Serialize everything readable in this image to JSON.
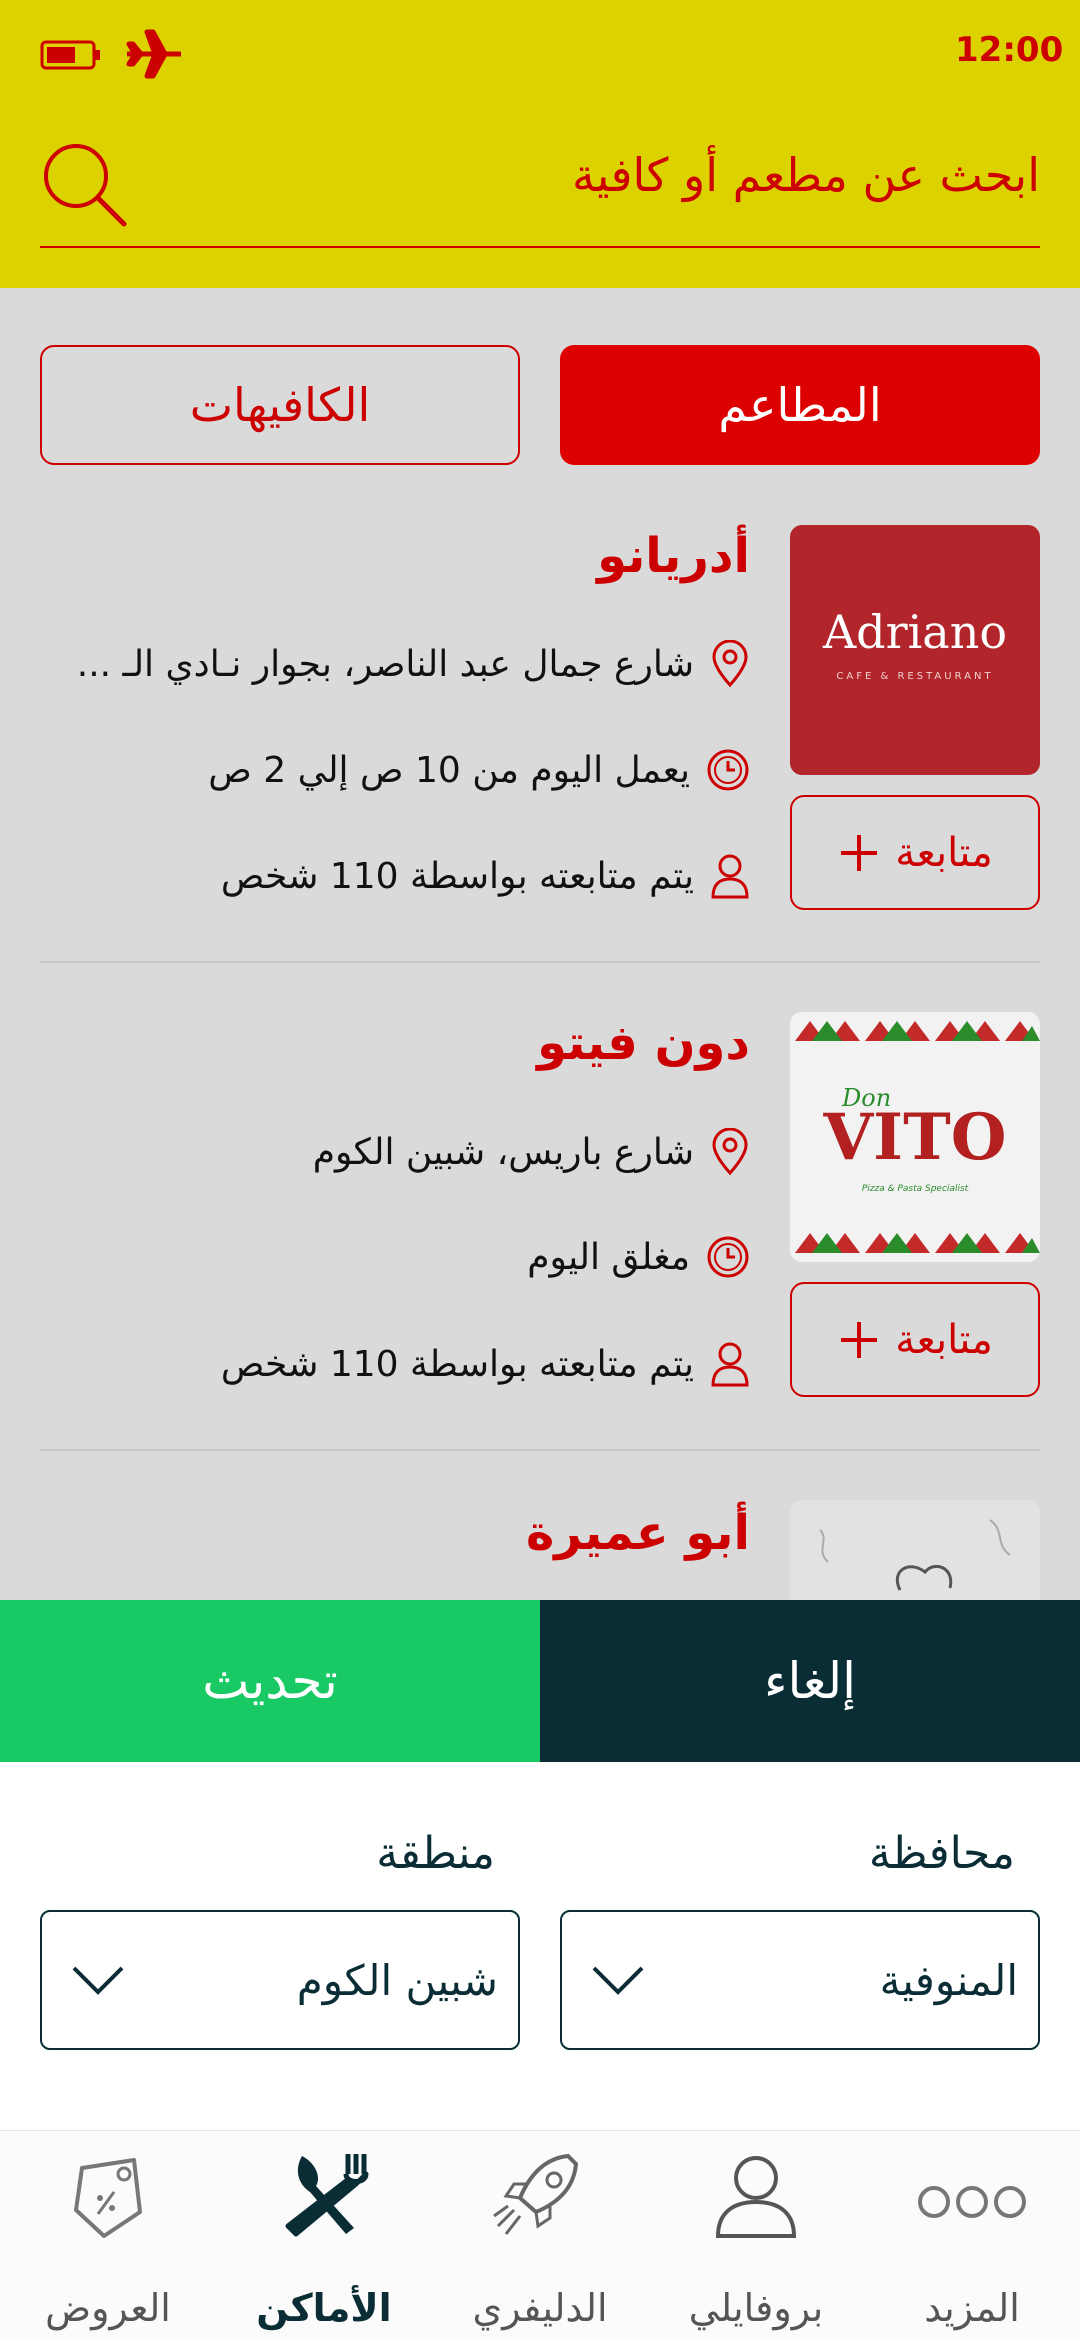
{
  "status_bar": {
    "time": "12:00"
  },
  "search": {
    "placeholder": "ابحث عن مطعم أو كافية"
  },
  "tabs": {
    "restaurants": "المطاعم",
    "cafes": "الكافيهات"
  },
  "places": [
    {
      "name": "أدريانو",
      "address": "شارع جمال عبد الناصر، بجوار نـادي الـ ...",
      "hours": "يعمل اليوم من 10 ص إلي 2 ص",
      "followers": "يتم متابعته بواسطة 110 شخص",
      "follow_label": "متابعة",
      "logo_text": "Adriano",
      "logo_sub": "CAFE & RESTAURANT"
    },
    {
      "name": "دون فيتو",
      "address": "شارع باريس، شبين الكوم",
      "hours": "مغلق اليوم",
      "followers": "يتم متابعته بواسطة 110 شخص",
      "follow_label": "متابعة",
      "logo_text": "VITO",
      "logo_small": "Don",
      "logo_sub": "Pizza & Pasta Specialist"
    },
    {
      "name": "أبو عميرة"
    }
  ],
  "filter": {
    "update_label": "تحديث",
    "cancel_label": "إلغاء",
    "governorate_label": "محافظة",
    "governorate_value": "المنوفية",
    "area_label": "منطقة",
    "area_value": "شبين الكوم"
  },
  "nav": [
    {
      "label": "المزيد",
      "icon": "more-icon"
    },
    {
      "label": "بروفايلي",
      "icon": "profile-icon"
    },
    {
      "label": "الدليفري",
      "icon": "rocket-icon"
    },
    {
      "label": "الأماكن",
      "icon": "fork-knife-icon",
      "active": true
    },
    {
      "label": "العروض",
      "icon": "tag-icon"
    }
  ],
  "colors": {
    "accent": "#dd0000",
    "header": "#dcd200",
    "green": "#18c964",
    "dark": "#0a2d35"
  }
}
